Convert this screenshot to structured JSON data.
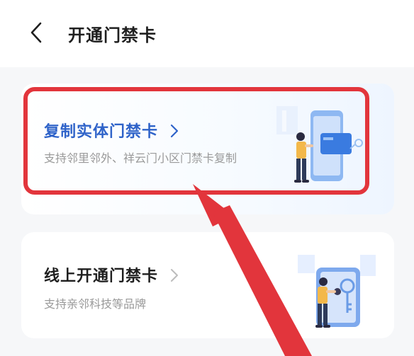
{
  "header": {
    "title": "开通门禁卡"
  },
  "cards": [
    {
      "title": "复制实体门禁卡",
      "description": "支持邻里邻外、祥云门小区门禁卡复制"
    },
    {
      "title": "线上开通门禁卡",
      "description": "支持亲邻科技等品牌"
    }
  ],
  "colors": {
    "accent": "#2f63c9",
    "annotation_red": "#e2353c"
  }
}
